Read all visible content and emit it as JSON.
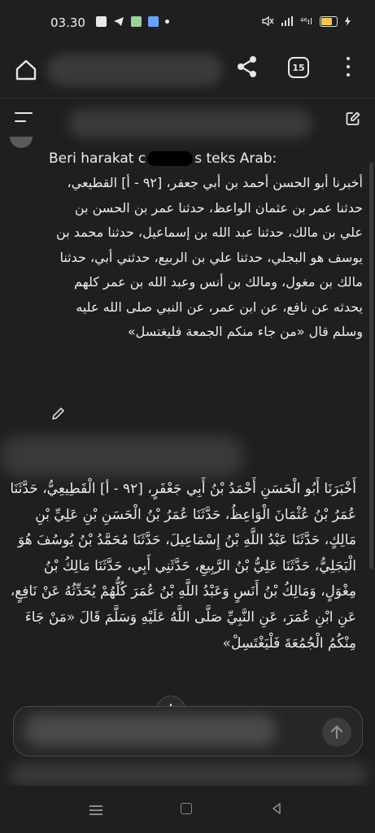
{
  "status_bar": {
    "time": "03.30",
    "signal_text": "⁴⁶ıl"
  },
  "browser": {
    "tab_count": "15"
  },
  "conversation": {
    "user_message": {
      "prefix_start": "Beri harakat",
      "prefix_c": "c",
      "prefix_end": "s teks Arab:",
      "arabic_text": "أخبرنا أبو الحسن أحمد بن أبي جعفر، [٩٢ - أ] القطيعي، حدثنا عمر بن عثمان الواعظ، حدثنا عمر بن الحسن بن علي بن مالك، حدثنا عبد الله بن إسماعيل، حدثنا محمد بن يوسف هو البجلي، حدثنا علي بن الربيع، حدثني أبي، حدثنا مالك بن مغول، ومالك بن أنس وعبد الله بن عمر كلهم يحدثه عن نافع، عن ابن عمر، عن النبي صلى الله عليه وسلم قال «من جاء منكم الجمعة فليغتسل»"
    },
    "assistant_message": {
      "arabic_text": "أَخْبَرَنَا أَبُو الْحَسَنِ أَحْمَدُ بْنُ أَبِي جَعْفَرٍ، [٩٢ - أ] الْقَطِيعِيُّ، حَدَّثَنَا عُمَرُ بْنُ عُثْمَانَ الْوَاعِظُ، حَدَّثَنَا عُمَرُ بْنُ الْحَسَنِ بْنِ عَلِيِّ بْنِ مَالِكٍ، حَدَّثَنَا عَبْدُ اللَّهِ بْنُ إِسْمَاعِيلَ، حَدَّثَنَا مُحَمَّدُ بْنُ يُوسُفَ هُوَ الْبَجَلِيُّ، حَدَّثَنَا عَلِيُّ بْنُ الرَّبِيعِ، حَدَّثَنِي أَبِي، حَدَّثَنَا مَالِكُ بْنُ مِغْوَلٍ، وَمَالِكُ بْنُ أَنَسٍ وَعَبْدُ اللَّهِ بْنُ عُمَرَ كُلُّهُمْ يُحَدِّثُهُ عَنْ نَافِعٍ، عَنِ ابْنِ عُمَرَ، عَنِ النَّبِيِّ صَلَّى اللَّهُ عَلَيْهِ وَسَلَّمَ قَالَ «مَنْ جَاءَ مِنْكُمُ الْجُمُعَةَ فَلْيَغْتَسِلْ»"
    }
  },
  "icons": {
    "home": "home-icon",
    "share": "share-icon",
    "tabs": "tabs-icon",
    "more": "more-vertical-icon",
    "menu": "menu-icon",
    "new_chat": "edit-icon",
    "edit_message": "pencil-icon",
    "scroll_down": "arrow-down-icon",
    "send": "arrow-up-icon"
  },
  "colors": {
    "background": "#1f1f1f",
    "text": "#ececec",
    "battery": "#f2c94c"
  }
}
